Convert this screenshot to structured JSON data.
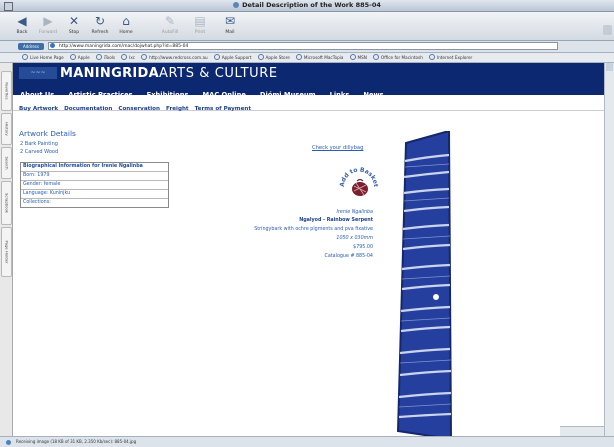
{
  "window": {
    "title": "Detail Description of the Work 885-04"
  },
  "toolbar": {
    "buttons": [
      {
        "label": "Back",
        "icon": "back-arrow-icon",
        "enabled": true
      },
      {
        "label": "Forward",
        "icon": "forward-arrow-icon",
        "enabled": false
      },
      {
        "label": "Stop",
        "icon": "stop-icon",
        "enabled": true
      },
      {
        "label": "Refresh",
        "icon": "refresh-icon",
        "enabled": true
      },
      {
        "label": "Home",
        "icon": "home-icon",
        "enabled": true
      },
      {
        "label": "AutoFill",
        "icon": "autofill-icon",
        "enabled": false
      },
      {
        "label": "Print",
        "icon": "print-icon",
        "enabled": false
      },
      {
        "label": "Mail",
        "icon": "mail-icon",
        "enabled": true
      }
    ]
  },
  "address": {
    "label": "Address",
    "url": "http://www.maningrida.com/mac/dojwhat.php?id=885-04"
  },
  "favorites": [
    "Live Home Page",
    "Apple",
    "iTools",
    "Ixc",
    "http://www.redcross.com.au",
    "Apple Support",
    "Apple Store",
    "Microsoft MacTopia",
    "MSN",
    "Office for Macintosh",
    "Internet Explorer"
  ],
  "sidetabs": [
    "Favorites",
    "History",
    "Search",
    "Scrapbook",
    "Page Holder"
  ],
  "site": {
    "brand_bold": "MANINGRIDA",
    "brand_light": "ARTS & CULTURE",
    "nav": [
      "About Us",
      "Artistic Practices",
      "Exhibitions",
      "MAC Online",
      "Djómi Museum",
      "Links",
      "News"
    ],
    "subnav": [
      "Buy Artwork",
      "Documentation",
      "Conservation",
      "Freight",
      "Terms of Payment"
    ]
  },
  "artwork": {
    "heading": "Artwork Details",
    "links": [
      "2 Bark Painting",
      "2 Carved Wood"
    ],
    "bio_title": "Biographical Information for Irenie Ngalinba",
    "bio_rows": [
      "Born: 1979",
      "Gender: female",
      "Language: Kuninjku",
      "Collections:"
    ],
    "check_link": "Check your dillybag",
    "seal_text": "Add to Basket",
    "artist": "Irenie Ngalinba",
    "title": "Ngalyod - Rainbow Serpent",
    "medium": "Stringybark with ochre pigments and pva fixative",
    "dimensions": "1050 x 030mm",
    "price": "$795.00",
    "catalogue": "Catalogue # 885-04"
  },
  "status": {
    "text": "Receiving image (18 KB of 31 KB, 2.350 Kb/sec): 885-04.jpg"
  },
  "colors": {
    "header": "#0c2870",
    "link": "#2a5db0",
    "artwork_blue": "#2f4aa5"
  }
}
